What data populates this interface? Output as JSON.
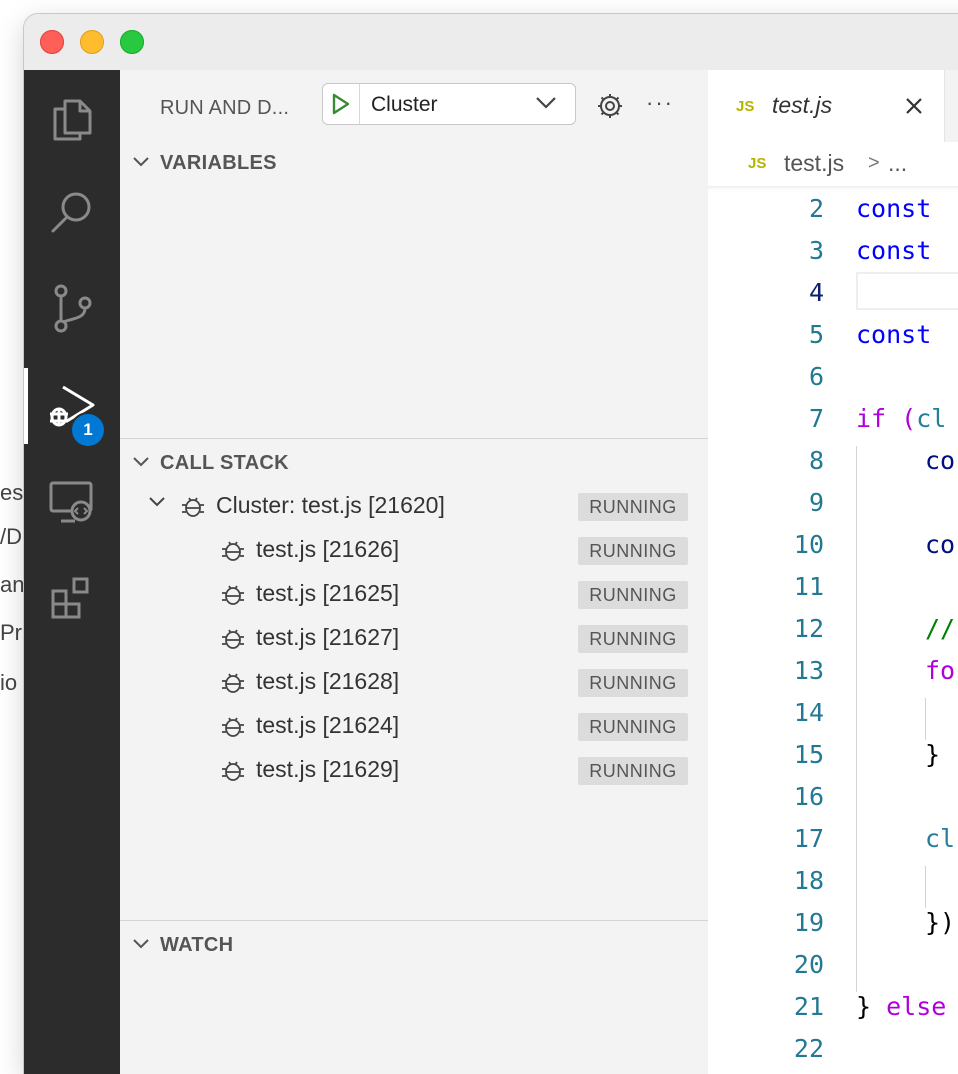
{
  "background_fragments": [
    "es",
    "/D",
    "an",
    "Pr",
    "io"
  ],
  "colors": {
    "activity_bg": "#2c2c2c",
    "sidebar_bg": "#f3f3f3",
    "badge": "#0078d4",
    "keyword": "#0000ff",
    "control": "#af00db",
    "variable": "#001080",
    "identifier": "#267f99",
    "comment": "#008000",
    "line_number": "#237893"
  },
  "activity_bar": {
    "items": [
      {
        "name": "explorer",
        "icon": "files-icon"
      },
      {
        "name": "search",
        "icon": "search-icon"
      },
      {
        "name": "source-control",
        "icon": "source-control-icon"
      },
      {
        "name": "run-and-debug",
        "icon": "run-debug-icon",
        "active": true,
        "badge": "1"
      },
      {
        "name": "remote-explorer",
        "icon": "remote-explorer-icon"
      },
      {
        "name": "extensions",
        "icon": "extensions-icon"
      }
    ]
  },
  "sidebar": {
    "title": "RUN AND D...",
    "config_select": {
      "value": "Cluster"
    },
    "sections": {
      "variables": "VARIABLES",
      "call_stack": "CALL STACK",
      "watch": "WATCH"
    },
    "call_stack": {
      "session": {
        "name": "Cluster: test.js [21620]",
        "state": "RUNNING"
      },
      "threads": [
        {
          "name": "test.js [21626]",
          "state": "RUNNING"
        },
        {
          "name": "test.js [21625]",
          "state": "RUNNING"
        },
        {
          "name": "test.js [21627]",
          "state": "RUNNING"
        },
        {
          "name": "test.js [21628]",
          "state": "RUNNING"
        },
        {
          "name": "test.js [21624]",
          "state": "RUNNING"
        },
        {
          "name": "test.js [21629]",
          "state": "RUNNING"
        }
      ]
    }
  },
  "editor": {
    "tab": {
      "lang_badge": "JS",
      "filename": "test.js"
    },
    "breadcrumb": {
      "lang_badge": "JS",
      "file": "test.js",
      "separator": ">",
      "rest": "..."
    },
    "lines": [
      {
        "num": "2",
        "text": "const",
        "kind": "keyword",
        "indent": 0
      },
      {
        "num": "3",
        "text": "const",
        "kind": "keyword",
        "indent": 0
      },
      {
        "num": "4",
        "text": "",
        "kind": "plain",
        "indent": 0,
        "current": true
      },
      {
        "num": "5",
        "text": "const",
        "kind": "keyword",
        "indent": 0
      },
      {
        "num": "6",
        "text": "",
        "kind": "plain",
        "indent": 0
      },
      {
        "num": "7",
        "text": "if (cl",
        "kind": "if",
        "indent": 0
      },
      {
        "num": "8",
        "text": "co",
        "kind": "variable",
        "indent": 1
      },
      {
        "num": "9",
        "text": "",
        "kind": "plain",
        "indent": 1
      },
      {
        "num": "10",
        "text": "co",
        "kind": "variable",
        "indent": 1
      },
      {
        "num": "11",
        "text": "",
        "kind": "plain",
        "indent": 1
      },
      {
        "num": "12",
        "text": "//",
        "kind": "comment",
        "indent": 1
      },
      {
        "num": "13",
        "text": "fo",
        "kind": "control",
        "indent": 1
      },
      {
        "num": "14",
        "text": "",
        "kind": "plain",
        "indent": 2
      },
      {
        "num": "15",
        "text": "}",
        "kind": "plain",
        "indent": 1
      },
      {
        "num": "16",
        "text": "",
        "kind": "plain",
        "indent": 1
      },
      {
        "num": "17",
        "text": "cl",
        "kind": "identifier",
        "indent": 1
      },
      {
        "num": "18",
        "text": "",
        "kind": "plain",
        "indent": 2
      },
      {
        "num": "19",
        "text": "})",
        "kind": "plain",
        "indent": 1
      },
      {
        "num": "20",
        "text": "",
        "kind": "plain",
        "indent": 1
      },
      {
        "num": "21",
        "text": "} else",
        "kind": "else",
        "indent": 0
      },
      {
        "num": "22",
        "text": "",
        "kind": "plain",
        "indent": 0
      }
    ]
  }
}
